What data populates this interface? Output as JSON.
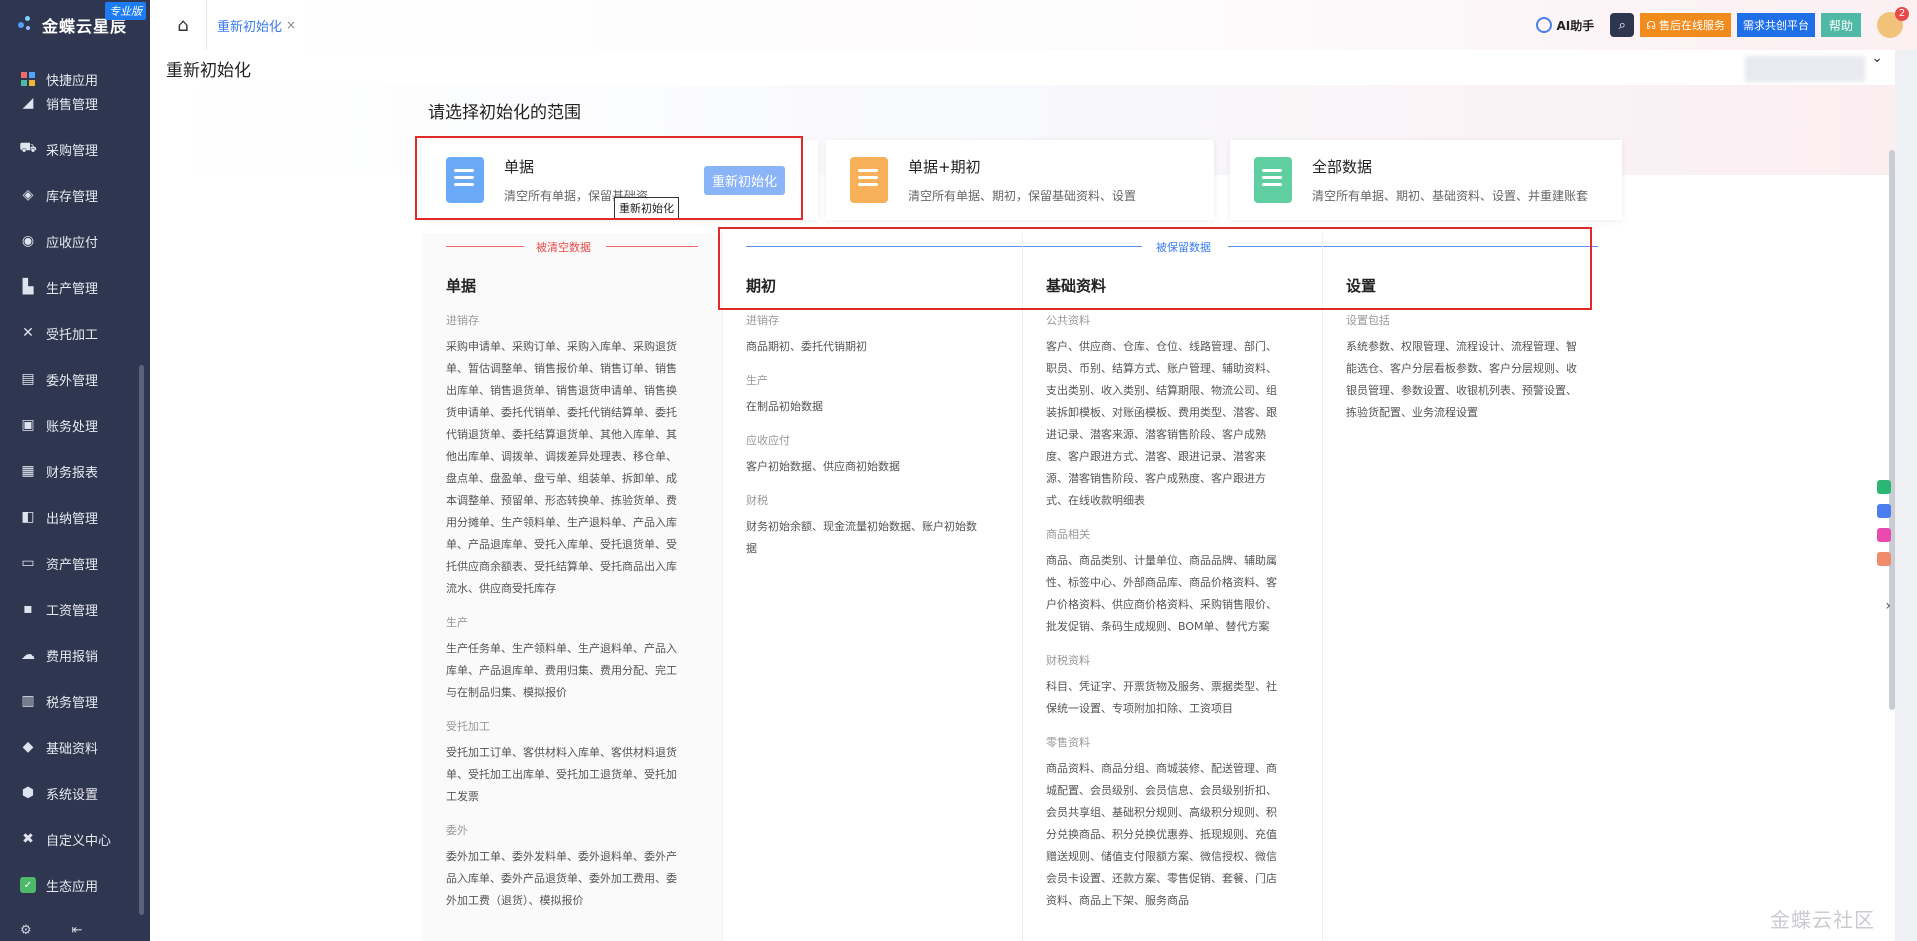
{
  "app": {
    "logo_text": "金蝶云星辰",
    "logo_badge": "专业版"
  },
  "sidebar": {
    "items": [
      {
        "label": "快捷应用",
        "icon": "grid-icon"
      },
      {
        "label": "销售管理",
        "icon": "chart-icon"
      },
      {
        "label": "采购管理",
        "icon": "cart-icon"
      },
      {
        "label": "库存管理",
        "icon": "box-icon"
      },
      {
        "label": "应收应付",
        "icon": "coin-icon"
      },
      {
        "label": "生产管理",
        "icon": "factory-icon"
      },
      {
        "label": "受托加工",
        "icon": "tools-icon"
      },
      {
        "label": "委外管理",
        "icon": "outsource-icon"
      },
      {
        "label": "账务处理",
        "icon": "ledger-icon"
      },
      {
        "label": "财务报表",
        "icon": "report-icon"
      },
      {
        "label": "出纳管理",
        "icon": "cashier-icon"
      },
      {
        "label": "资产管理",
        "icon": "asset-icon"
      },
      {
        "label": "工资管理",
        "icon": "salary-icon"
      },
      {
        "label": "费用报销",
        "icon": "expense-icon"
      },
      {
        "label": "税务管理",
        "icon": "tax-icon"
      },
      {
        "label": "基础资料",
        "icon": "layers-icon"
      },
      {
        "label": "系统设置",
        "icon": "settings-icon"
      },
      {
        "label": "自定义中心",
        "icon": "custom-icon"
      },
      {
        "label": "生态应用",
        "icon": "eco-icon"
      }
    ]
  },
  "topbar": {
    "tab_label": "重新初始化",
    "ai_label": "AI助手",
    "service_label": "售后在线服务",
    "demand_label": "需求共创平台",
    "help_label": "帮助",
    "notification_count": "2"
  },
  "page": {
    "title": "重新初始化",
    "scope_title": "请选择初始化的范围",
    "tooltip": "重新初始化",
    "watermark": "金蝶云社区"
  },
  "cards": [
    {
      "title": "单据",
      "desc": "清空所有单据，保留基础资...",
      "button": "重新初始化",
      "color": "#6aa9f5"
    },
    {
      "title": "单据+期初",
      "desc": "清空所有单据、期初，保留基础资料、设置",
      "color": "#f8b05a"
    },
    {
      "title": "全部数据",
      "desc": "清空所有单据、期初、基础资料、设置、并重建账套",
      "color": "#5fcfa2"
    }
  ],
  "sections": {
    "cleared": "被清空数据",
    "kept": "被保留数据"
  },
  "columns": {
    "bills": {
      "title": "单据",
      "groups": [
        {
          "name": "进销存",
          "text": "采购申请单、采购订单、采购入库单、采购退货单、暂估调整单、销售报价单、销售订单、销售出库单、销售退货单、销售退货申请单、销售换货申请单、委托代销单、委托代销结算单、委托代销退货单、委托结算退货单、其他入库单、其他出库单、调拨单、调拨差异处理表、移仓单、盘点单、盘盈单、盘亏单、组装单、拆卸单、成本调整单、预留单、形态转换单、拣验货单、费用分摊单、生产领料单、生产退料单、产品入库单、产品退库单、受托入库单、受托退货单、受托供应商余额表、受托结算单、受托商品出入库流水、供应商受托库存"
        },
        {
          "name": "生产",
          "text": "生产任务单、生产领料单、生产退料单、产品入库单、产品退库单、费用归集、费用分配、完工与在制品归集、模拟报价"
        },
        {
          "name": "受托加工",
          "text": "受托加工订单、客供材料入库单、客供材料退货单、受托加工出库单、受托加工退货单、受托加工发票"
        },
        {
          "name": "委外",
          "text": "委外加工单、委外发料单、委外退料单、委外产品入库单、委外产品退货单、委外加工费用、委外加工费（退货）、模拟报价"
        }
      ]
    },
    "opening": {
      "title": "期初",
      "groups": [
        {
          "name": "进销存",
          "text": "商品期初、委托代销期初"
        },
        {
          "name": "生产",
          "text": "在制品初始数据"
        },
        {
          "name": "应收应付",
          "text": "客户初始数据、供应商初始数据"
        },
        {
          "name": "财税",
          "text": "财务初始余额、现金流量初始数据、账户初始数据"
        }
      ]
    },
    "basic": {
      "title": "基础资料",
      "groups": [
        {
          "name": "公共资料",
          "text": "客户、供应商、仓库、仓位、线路管理、部门、职员、币别、结算方式、账户管理、辅助资料、支出类别、收入类别、结算期限、物流公司、组装拆卸模板、对账函模板、费用类型、潜客、跟进记录、潜客来源、潜客销售阶段、客户成熟度、客户跟进方式、潜客、跟进记录、潜客来源、潜客销售阶段、客户成熟度、客户跟进方式、在线收款明细表"
        },
        {
          "name": "商品相关",
          "text": "商品、商品类别、计量单位、商品品牌、辅助属性、标签中心、外部商品库、商品价格资料、客户价格资料、供应商价格资料、采购销售限价、批发促销、条码生成规则、BOM单、替代方案"
        },
        {
          "name": "财税资料",
          "text": "科目、凭证字、开票货物及服务、票据类型、社保统一设置、专项附加扣除、工资项目"
        },
        {
          "name": "零售资料",
          "text": "商品资料、商品分组、商城装修、配送管理、商城配置、会员级别、会员信息、会员级别折扣、会员共享组、基础积分规则、高级积分规则、积分兑换商品、积分兑换优惠券、抵现规则、充值赠送规则、储值支付限额方案、微信授权、微信会员卡设置、还款方案、零售促销、套餐、门店资料、商品上下架、服务商品"
        }
      ]
    },
    "settings": {
      "title": "设置",
      "groups": [
        {
          "name": "设置包括",
          "text": "系统参数、权限管理、流程设计、流程管理、智能选仓、客户分层看板参数、客户分层规则、收银员管理、参数设置、收银机列表、预警设置、拣验货配置、业务流程设置"
        }
      ]
    }
  }
}
